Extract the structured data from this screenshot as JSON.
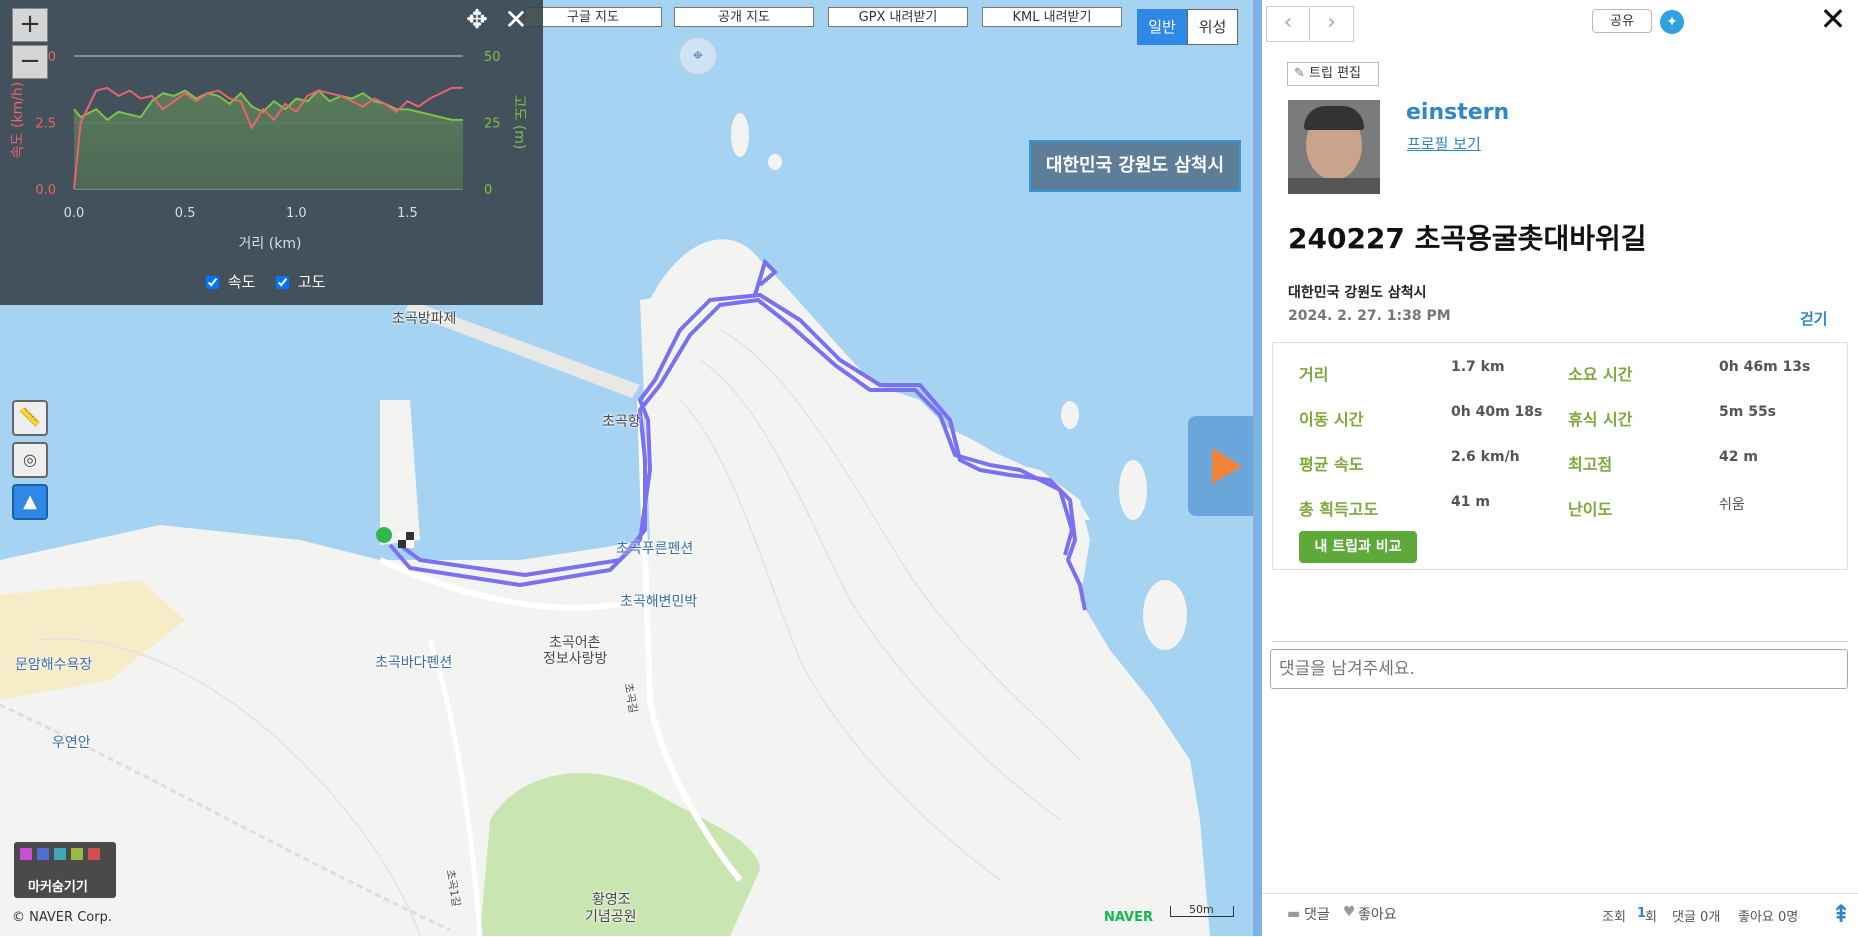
{
  "map": {
    "top_buttons": [
      "구글 지도",
      "공개 지도",
      "GPX 내려받기",
      "KML 내려받기"
    ],
    "map_types": [
      "일반",
      "위성"
    ],
    "region_label": "대한민국 강원도 삼척시",
    "pois": [
      "초곡방파제",
      "초곡항",
      "초곡푸른펜션",
      "초곡해변민박",
      "초곡어촌",
      "정보사랑방",
      "초곡바다펜션",
      "문암해수욕장",
      "우연안",
      "황영조",
      "기념공원",
      "초곡길",
      "초곡1길"
    ],
    "marker_hide_label": "마커숨기기",
    "copyright": "© NAVER Corp.",
    "naver": "NAVER",
    "scale": "50m"
  },
  "chart": {
    "xlabel": "거리 (km)",
    "ylabel_left": "속도 (km/h)",
    "ylabel_right": "고도 (m)",
    "legend_speed": "속도",
    "legend_elev": "고도",
    "left_ticks": [
      "5.0",
      "2.5",
      "0.0"
    ],
    "right_ticks": [
      "50",
      "25",
      "0"
    ],
    "x_ticks": [
      "0.0",
      "0.5",
      "1.0",
      "1.5"
    ]
  },
  "chart_data": {
    "type": "line",
    "x": [
      0.0,
      0.03,
      0.1,
      0.15,
      0.2,
      0.25,
      0.3,
      0.35,
      0.4,
      0.45,
      0.5,
      0.55,
      0.6,
      0.65,
      0.7,
      0.75,
      0.8,
      0.85,
      0.9,
      0.95,
      1.0,
      1.05,
      1.1,
      1.15,
      1.2,
      1.25,
      1.3,
      1.35,
      1.4,
      1.45,
      1.5,
      1.55,
      1.6,
      1.65,
      1.7,
      1.75
    ],
    "series": [
      {
        "name": "속도",
        "axis": "left",
        "color": "#e8646e",
        "values": [
          0.0,
          2.5,
          3.7,
          3.8,
          3.5,
          3.7,
          3.4,
          3.5,
          3.0,
          3.3,
          3.6,
          3.3,
          3.6,
          3.7,
          3.4,
          3.3,
          2.3,
          3.0,
          2.6,
          3.2,
          2.9,
          3.5,
          3.7,
          3.6,
          3.5,
          3.3,
          3.1,
          3.4,
          3.2,
          2.9,
          3.3,
          3.1,
          3.4,
          3.6,
          3.8,
          3.8
        ]
      },
      {
        "name": "고도",
        "axis": "right",
        "color": "#7fc24a",
        "values": [
          30,
          27,
          30,
          26,
          29,
          28,
          27,
          33,
          36,
          35,
          37,
          34,
          36,
          35,
          32,
          36,
          31,
          29,
          33,
          30,
          34,
          33,
          37,
          33,
          35,
          34,
          36,
          33,
          32,
          30,
          30,
          29,
          28,
          27,
          26,
          26
        ]
      }
    ],
    "xlim": [
      0,
      1.75
    ],
    "ylim_left": [
      0,
      5
    ],
    "ylim_right": [
      0,
      50
    ],
    "grid": false,
    "legend": "bottom"
  },
  "side": {
    "share": "공유",
    "edit_trip": "트립 편집",
    "username": "einstern",
    "profile_link": "프로필 보기",
    "title": "240227 초곡용굴촛대바위길",
    "location": "대한민국 강원도 삼척시",
    "datetime": "2024. 2. 27. 1:38 PM",
    "activity": "걷기",
    "stats": [
      {
        "label": "거리",
        "value": "1.7 km",
        "label2": "소요 시간",
        "value2": "0h 46m 13s"
      },
      {
        "label": "이동 시간",
        "value": "0h 40m 18s",
        "label2": "휴식 시간",
        "value2": "5m 55s"
      },
      {
        "label": "평균 속도",
        "value": "2.6 km/h",
        "label2": "최고점",
        "value2": "42 m"
      },
      {
        "label": "총 획득고도",
        "value": "41 m",
        "label2": "난이도",
        "value2": "쉬움"
      }
    ],
    "compare_button": "내 트립과 비교",
    "comment_placeholder": "댓글을 남겨주세요.",
    "footer_comment": "댓글",
    "footer_like": "좋아요",
    "views_label": "조회",
    "views_count": "1",
    "views_unit": "회",
    "comments_count": "댓글 0개",
    "likes_count": "좋아요 0명"
  }
}
